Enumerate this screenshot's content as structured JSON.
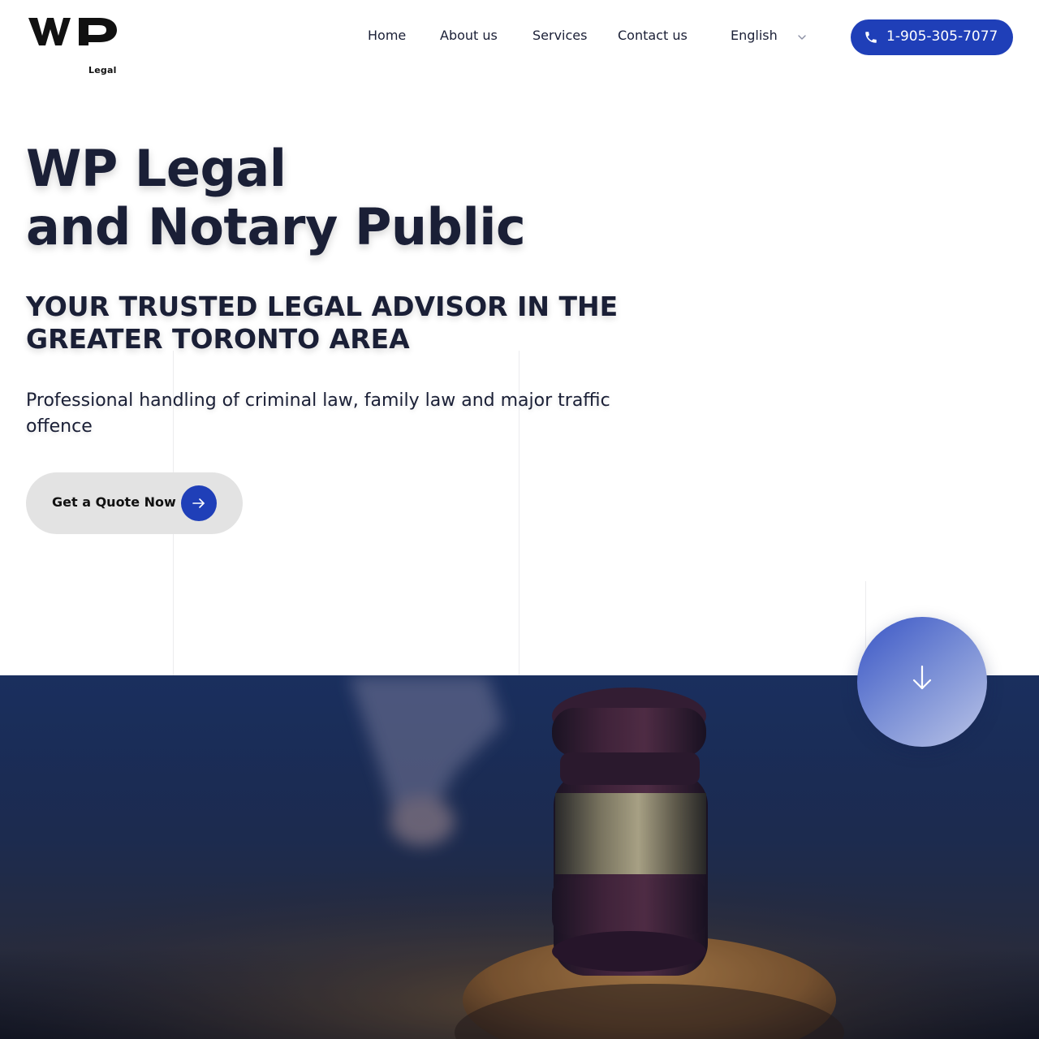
{
  "header": {
    "logo": {
      "mark_text": "WP",
      "sub_text": "Legal"
    },
    "nav": [
      {
        "label": "Home"
      },
      {
        "label": "About us"
      },
      {
        "label": "Services"
      },
      {
        "label": "Contact us"
      }
    ],
    "language": {
      "selected": "English",
      "icon": "chevron-down-icon"
    },
    "phone": {
      "label": "1-905-305-7077",
      "icon": "phone-icon"
    }
  },
  "hero": {
    "title_line1": "WP Legal",
    "title_line2": "and Notary Public",
    "subtitle": "YOUR TRUSTED LEGAL ADVISOR IN THE GREATER TORONTO AREA",
    "description": "Professional handling of criminal law, family law and major traffic offence",
    "cta": {
      "label": "Get a Quote Now",
      "icon": "arrow-right-icon"
    },
    "scroll_button": {
      "icon": "arrow-down-icon"
    },
    "image": {
      "subject": "gavel-image"
    }
  },
  "colors": {
    "accent": "#1f3fb8",
    "text": "#1a1f36",
    "button_bg": "#e3e3e3",
    "image_overlay": "#16275a"
  }
}
